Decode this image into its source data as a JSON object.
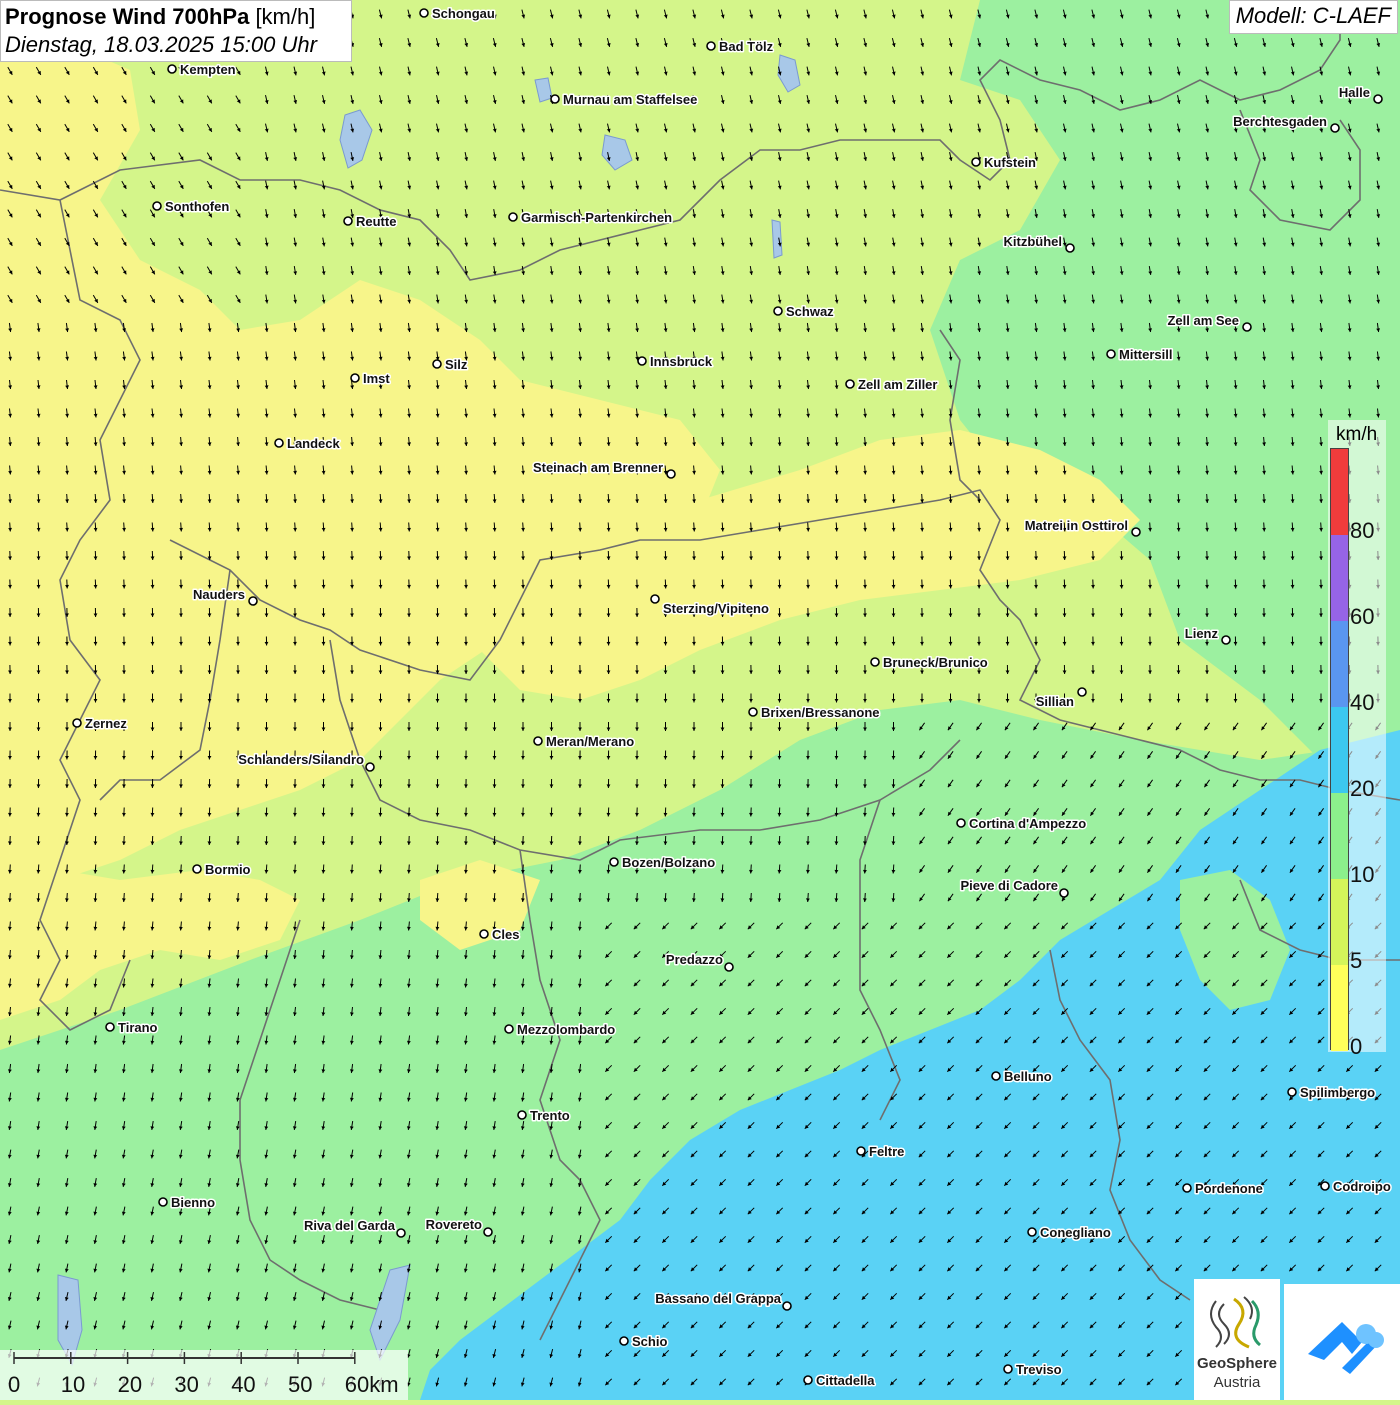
{
  "header": {
    "title_bold": "Prognose Wind 700hPa",
    "title_unit": "[km/h]",
    "subtitle": "Dienstag, 18.03.2025 15:00 Uhr",
    "model": "Modell: C-LAEF"
  },
  "legend": {
    "unit": "km/h",
    "ticks": [
      "0",
      "5",
      "10",
      "20",
      "40",
      "60",
      "80"
    ],
    "colors": [
      "#ffff5a",
      "#d4f55a",
      "#8cf08c",
      "#3cc8f0",
      "#5a96f0",
      "#9664e6",
      "#f03c3c"
    ]
  },
  "map_colors": {
    "yellow": "#f7f58a",
    "lightgreen": "#d4f58a",
    "green": "#9cf0a0",
    "blue": "#5ad2f5",
    "arrow": "#000000",
    "border": "#6e6e6e"
  },
  "cities": [
    {
      "name": "Schongau",
      "pos": [
        424,
        13
      ],
      "anchor": "right"
    },
    {
      "name": "Bad Tölz",
      "pos": [
        711,
        46
      ],
      "anchor": "right"
    },
    {
      "name": "Kempten",
      "pos": [
        172,
        69
      ],
      "anchor": "right"
    },
    {
      "name": "Murnau am Staffelsee",
      "pos": [
        555,
        99
      ],
      "anchor": "right"
    },
    {
      "name": "Halle",
      "pos": [
        1378,
        99
      ],
      "anchor": "left"
    },
    {
      "name": "Berchtesgaden",
      "pos": [
        1335,
        128
      ],
      "anchor": "left"
    },
    {
      "name": "Kufstein",
      "pos": [
        976,
        162
      ],
      "anchor": "right"
    },
    {
      "name": "Sonthofen",
      "pos": [
        157,
        206
      ],
      "anchor": "right"
    },
    {
      "name": "Reutte",
      "pos": [
        348,
        221
      ],
      "anchor": "right"
    },
    {
      "name": "Garmisch-Partenkirchen",
      "pos": [
        513,
        217
      ],
      "anchor": "right"
    },
    {
      "name": "Kitzbühel",
      "pos": [
        1070,
        248
      ],
      "anchor": "left"
    },
    {
      "name": "Schwaz",
      "pos": [
        778,
        311
      ],
      "anchor": "right"
    },
    {
      "name": "Zell am See",
      "pos": [
        1247,
        327
      ],
      "anchor": "left"
    },
    {
      "name": "Mittersill",
      "pos": [
        1111,
        354
      ],
      "anchor": "right"
    },
    {
      "name": "Silz",
      "pos": [
        437,
        364
      ],
      "anchor": "right"
    },
    {
      "name": "Innsbruck",
      "pos": [
        642,
        361
      ],
      "anchor": "right"
    },
    {
      "name": "Imst",
      "pos": [
        355,
        378
      ],
      "anchor": "right"
    },
    {
      "name": "Zell am Ziller",
      "pos": [
        850,
        384
      ],
      "anchor": "right"
    },
    {
      "name": "Landeck",
      "pos": [
        279,
        443
      ],
      "anchor": "right"
    },
    {
      "name": "Steinach am Brenner",
      "pos": [
        671,
        474
      ],
      "anchor": "left"
    },
    {
      "name": "Matrei in Osttirol",
      "pos": [
        1136,
        532
      ],
      "anchor": "left"
    },
    {
      "name": "Nauders",
      "pos": [
        253,
        601
      ],
      "anchor": "left"
    },
    {
      "name": "Sterzing/Vipiteno",
      "pos": [
        655,
        599
      ],
      "anchor": "below"
    },
    {
      "name": "Lienz",
      "pos": [
        1226,
        640
      ],
      "anchor": "left"
    },
    {
      "name": "Bruneck/Brunico",
      "pos": [
        875,
        662
      ],
      "anchor": "right"
    },
    {
      "name": "Sillian",
      "pos": [
        1082,
        692
      ],
      "anchor": "below-left"
    },
    {
      "name": "Brixen/Bressanone",
      "pos": [
        753,
        712
      ],
      "anchor": "right"
    },
    {
      "name": "Zernez",
      "pos": [
        77,
        723
      ],
      "anchor": "right"
    },
    {
      "name": "Meran/Merano",
      "pos": [
        538,
        741
      ],
      "anchor": "right"
    },
    {
      "name": "Schlanders/Silandro",
      "pos": [
        370,
        767
      ],
      "anchor": "left-up"
    },
    {
      "name": "Cortina d'Ampezzo",
      "pos": [
        961,
        823
      ],
      "anchor": "right"
    },
    {
      "name": "Bozen/Bolzano",
      "pos": [
        614,
        862
      ],
      "anchor": "right"
    },
    {
      "name": "Bormio",
      "pos": [
        197,
        869
      ],
      "anchor": "right"
    },
    {
      "name": "Pieve di Cadore",
      "pos": [
        1064,
        893
      ],
      "anchor": "left-up"
    },
    {
      "name": "Cles",
      "pos": [
        484,
        934
      ],
      "anchor": "right"
    },
    {
      "name": "Predazzo",
      "pos": [
        729,
        967
      ],
      "anchor": "left-up"
    },
    {
      "name": "Tirano",
      "pos": [
        110,
        1027
      ],
      "anchor": "right"
    },
    {
      "name": "Mezzolombardo",
      "pos": [
        509,
        1029
      ],
      "anchor": "right"
    },
    {
      "name": "Belluno",
      "pos": [
        996,
        1076
      ],
      "anchor": "right"
    },
    {
      "name": "Spilimbergo",
      "pos": [
        1292,
        1092
      ],
      "anchor": "right"
    },
    {
      "name": "Trento",
      "pos": [
        522,
        1115
      ],
      "anchor": "right"
    },
    {
      "name": "Feltre",
      "pos": [
        861,
        1151
      ],
      "anchor": "right"
    },
    {
      "name": "Pordenone",
      "pos": [
        1187,
        1188
      ],
      "anchor": "right"
    },
    {
      "name": "Codroipo",
      "pos": [
        1325,
        1186
      ],
      "anchor": "right"
    },
    {
      "name": "Bienno",
      "pos": [
        163,
        1202
      ],
      "anchor": "right"
    },
    {
      "name": "Riva del Garda",
      "pos": [
        401,
        1233
      ],
      "anchor": "left-up"
    },
    {
      "name": "Rovereto",
      "pos": [
        488,
        1232
      ],
      "anchor": "left-up"
    },
    {
      "name": "Conegliano",
      "pos": [
        1032,
        1232
      ],
      "anchor": "right"
    },
    {
      "name": "Bassano del Grappa",
      "pos": [
        787,
        1306
      ],
      "anchor": "left-up"
    },
    {
      "name": "Schio",
      "pos": [
        624,
        1341
      ],
      "anchor": "right"
    },
    {
      "name": "Treviso",
      "pos": [
        1008,
        1369
      ],
      "anchor": "right"
    },
    {
      "name": "Cittadella",
      "pos": [
        808,
        1380
      ],
      "anchor": "right"
    }
  ],
  "scale": {
    "labels": [
      "0",
      "10",
      "20",
      "30",
      "40",
      "50",
      "60km"
    ]
  },
  "logos": {
    "geosphere_line1": "GeoSphere",
    "geosphere_line2": "Austria"
  }
}
